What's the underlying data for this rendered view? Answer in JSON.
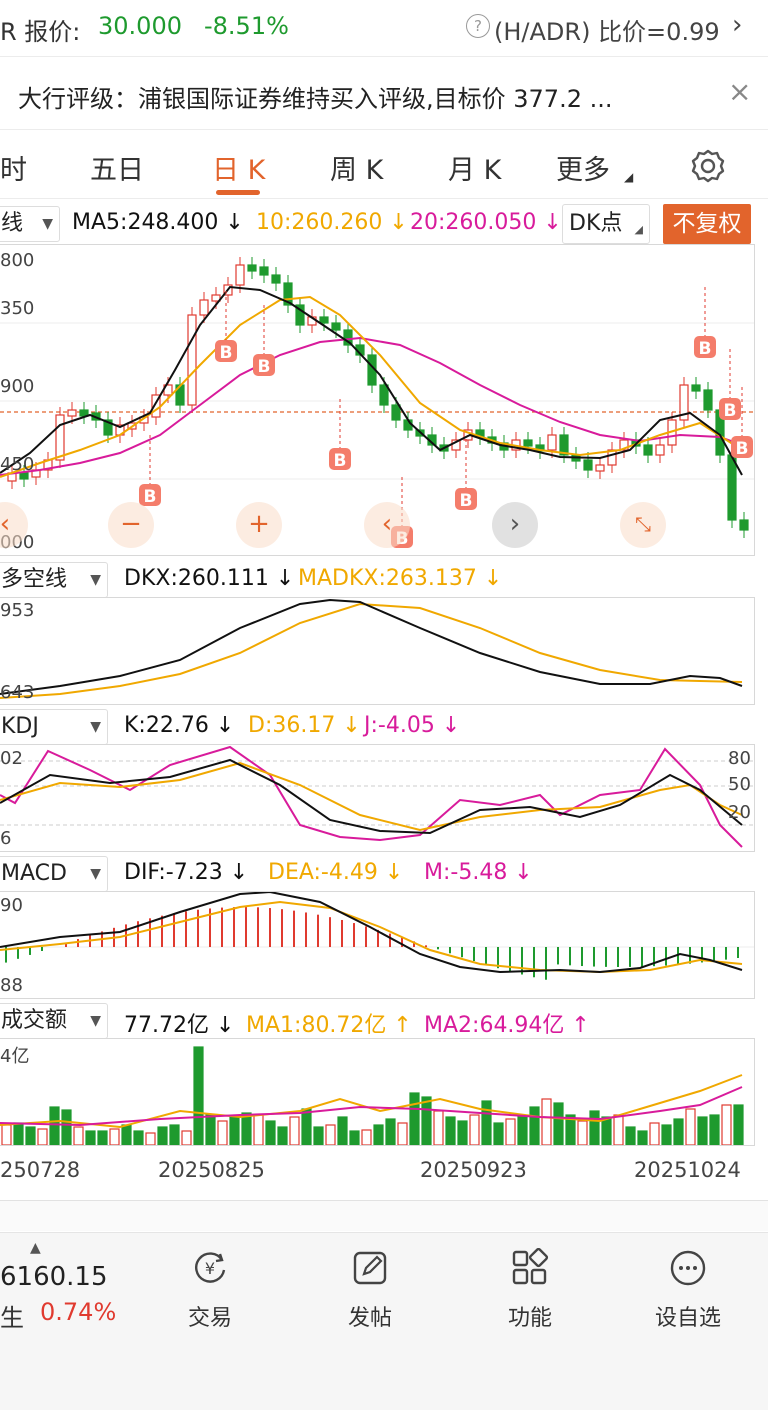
{
  "header": {
    "adr_prefix": "R 报价:",
    "adr_price": "30.000",
    "adr_change": "-8.51%",
    "ratio_text": "(H/ADR) 比价=0.99"
  },
  "notice": {
    "text": "大行评级：浦银国际证券维持买入评级,目标价 377.2 ..."
  },
  "tabs": {
    "t0": "时",
    "t1": "五日",
    "t2": "日 K",
    "t3": "周 K",
    "t4": "月 K",
    "t5": "更多"
  },
  "kline": {
    "indicator": "线",
    "ma5": "MA5:248.400 ↓",
    "ma10": "10:260.260 ↓",
    "ma20": "20:260.050 ↓",
    "dk": "DK点",
    "adjust": "不复权",
    "y_labels": [
      "800",
      "350",
      "900",
      "450",
      "000"
    ],
    "buy_marker": "B"
  },
  "dkx": {
    "name": "多空线",
    "dkx_val": "DKX:260.111 ↓",
    "madkx_val": "MADKX:263.137 ↓",
    "y_top": "953",
    "y_bottom": "643"
  },
  "kdj": {
    "name": "KDJ",
    "k": "K:22.76 ↓",
    "d": "D:36.17 ↓",
    "j": "J:-4.05 ↓",
    "y_top": "02",
    "y_bottom": "6",
    "levels": [
      "80",
      "50",
      "20"
    ]
  },
  "macd": {
    "name": "MACD",
    "dif": "DIF:-7.23 ↓",
    "dea": "DEA:-4.49 ↓",
    "m": "M:-5.48 ↓",
    "y_top": "90",
    "y_bottom": "88"
  },
  "volume": {
    "name": "成交额",
    "value": "77.72亿 ↓",
    "ma1": "MA1:80.72亿 ↑",
    "ma2": "MA2:64.94亿 ↑",
    "y_top": "4亿",
    "dates": [
      "250728",
      "20250825",
      "20250923",
      "20251024"
    ]
  },
  "index_ticker": {
    "value": "6160.15",
    "name": "生",
    "change": "0.74%"
  },
  "bottom_nav": {
    "trade": "交易",
    "post": "发帖",
    "function": "功能",
    "watchlist": "设自选"
  },
  "colors": {
    "up": "#e03a2f",
    "down": "#1e9a2e",
    "ma5": "#111111",
    "ma10": "#f0a800",
    "ma20": "#d81b9b",
    "accent": "#e2642c"
  }
}
